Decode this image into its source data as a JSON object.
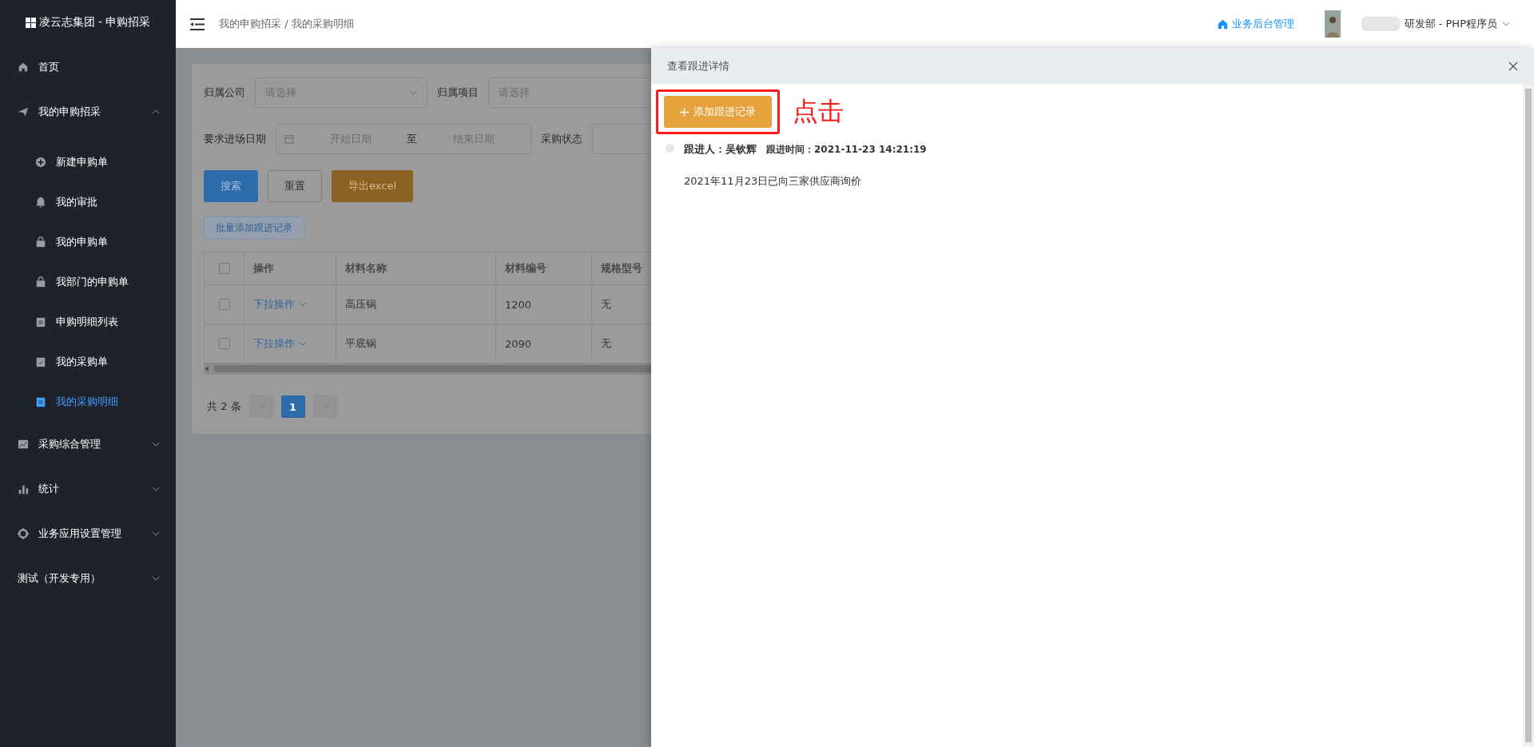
{
  "sidebar": {
    "logo": "凌云志集团 - 申购招采",
    "items": [
      {
        "label": "首页",
        "selected": false
      },
      {
        "label": "我的申购招采",
        "selected": false,
        "expanded": true,
        "children": [
          {
            "label": "新建申购单",
            "selected": false
          },
          {
            "label": "我的审批",
            "selected": false
          },
          {
            "label": "我的申购单",
            "selected": false
          },
          {
            "label": "我部门的申购单",
            "selected": false
          },
          {
            "label": "申购明细列表",
            "selected": false
          },
          {
            "label": "我的采购单",
            "selected": false
          },
          {
            "label": "我的采购明细",
            "selected": true
          }
        ]
      },
      {
        "label": "采购综合管理",
        "selected": false,
        "expanded": false
      },
      {
        "label": "统计",
        "selected": false,
        "expanded": false
      },
      {
        "label": "业务应用设置管理",
        "selected": false,
        "expanded": false
      },
      {
        "label": "测试（开发专用）",
        "selected": false,
        "expanded": false
      }
    ]
  },
  "header": {
    "breadcrumb": [
      "我的申购招采",
      "我的采购明细"
    ],
    "separator": "/",
    "admin_link": "业务后台管理",
    "user": "研发部 - PHP程序员"
  },
  "filters": {
    "company": {
      "label": "归属公司",
      "placeholder": "请选择"
    },
    "project": {
      "label": "归属项目",
      "placeholder": "请选择"
    },
    "date": {
      "label": "要求进场日期",
      "start": "开始日期",
      "separator": "至",
      "end": "结束日期"
    },
    "status": {
      "label": "采购状态"
    }
  },
  "buttons": [
    {
      "label": "搜索",
      "kind": "primary"
    },
    {
      "label": "重置",
      "kind": "plain"
    },
    {
      "label": "导出excel",
      "kind": "warning"
    }
  ],
  "batch_button": "批量添加跟进记录",
  "table": {
    "all_checked": false,
    "columns": [
      "操作",
      "材料名称",
      "材料编号",
      "规格型号"
    ],
    "rows": [
      {
        "checked": false,
        "action": "下拉操作",
        "name": "高压锅",
        "code": "1200",
        "spec": "无"
      },
      {
        "checked": false,
        "action": "下拉操作",
        "name": "平底锅",
        "code": "2090",
        "spec": "无"
      }
    ]
  },
  "pagination": {
    "total": "共 2 条",
    "pages": [
      {
        "label": "1",
        "selected": true
      }
    ]
  },
  "drawer": {
    "title": "查看跟进详情",
    "add_button": "添加跟进记录",
    "annotation": "点击",
    "records": [
      {
        "person_label": "跟进人：",
        "person": "吴钦辉",
        "time_label": "跟进时间：",
        "time": "2021-11-23 14:21:19",
        "content": "2021年11月23日已向三家供应商询价"
      }
    ]
  }
}
